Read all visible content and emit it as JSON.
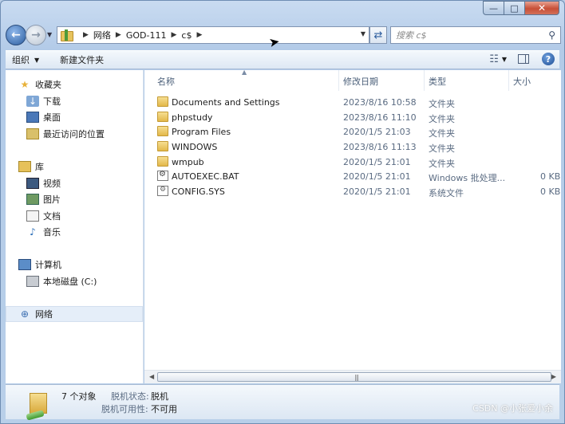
{
  "window": {
    "caption": {
      "minimize": "—",
      "maximize": "□",
      "close": "✕"
    }
  },
  "address": {
    "crumbs": [
      "网络",
      "GOD-111",
      "c$"
    ],
    "search_placeholder": "搜索 c$"
  },
  "toolbar": {
    "organize": "组织",
    "new_folder": "新建文件夹"
  },
  "nav": {
    "favorites": "收藏夹",
    "downloads": "下载",
    "desktop": "桌面",
    "recent": "最近访问的位置",
    "libraries": "库",
    "videos": "视频",
    "pictures": "图片",
    "documents": "文档",
    "music": "音乐",
    "computer": "计算机",
    "local_disk": "本地磁盘 (C:)",
    "network": "网络"
  },
  "columns": {
    "name": "名称",
    "modified": "修改日期",
    "type": "类型",
    "size": "大小"
  },
  "files": [
    {
      "icon": "folder-icon",
      "name": "Documents and Settings",
      "modified": "2023/8/16 10:58",
      "type": "文件夹",
      "size": ""
    },
    {
      "icon": "folder-icon",
      "name": "phpstudy",
      "modified": "2023/8/16 11:10",
      "type": "文件夹",
      "size": ""
    },
    {
      "icon": "folder-icon",
      "name": "Program Files",
      "modified": "2020/1/5 21:03",
      "type": "文件夹",
      "size": ""
    },
    {
      "icon": "folder-icon",
      "name": "WINDOWS",
      "modified": "2023/8/16 11:13",
      "type": "文件夹",
      "size": ""
    },
    {
      "icon": "folder-icon",
      "name": "wmpub",
      "modified": "2020/1/5 21:01",
      "type": "文件夹",
      "size": ""
    },
    {
      "icon": "batch-file-icon",
      "name": "AUTOEXEC.BAT",
      "modified": "2020/1/5 21:01",
      "type": "Windows 批处理...",
      "size": "0 KB"
    },
    {
      "icon": "system-file-icon",
      "name": "CONFIG.SYS",
      "modified": "2020/1/5 21:01",
      "type": "系统文件",
      "size": "0 KB"
    }
  ],
  "details": {
    "count": "7 个对象",
    "offline_status_label": "脱机状态:",
    "offline_status_value": "脱机",
    "offline_avail_label": "脱机可用性:",
    "offline_avail_value": "不可用"
  },
  "watermark": "CSDN @小张爱小余"
}
